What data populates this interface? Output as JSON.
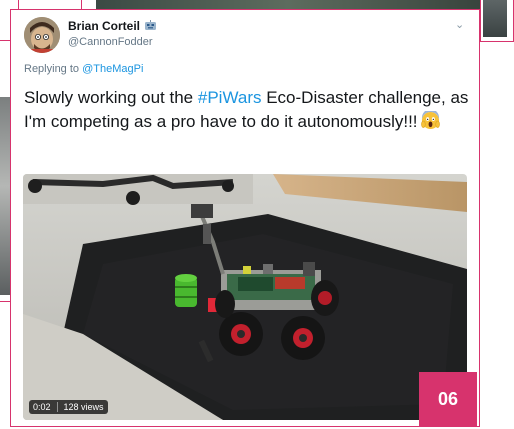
{
  "tweet": {
    "name": "Brian Corteil",
    "handle": "@CannonFodder",
    "reply_prefix": "Replying to",
    "reply_to": "@TheMagPi",
    "text_before": "Slowly working out the ",
    "hashtag": "#PiWars",
    "text_after": " Eco-Disaster challenge, as I'm competing as a  pro have to do it autonomously!!!",
    "emoji": "face-screaming-in-fear",
    "video_time": "0:02",
    "video_views": "128 views"
  },
  "page": {
    "number": "06"
  },
  "colors": {
    "accent": "#d7336d",
    "link": "#1b95e0",
    "text": "#14171a",
    "muted": "#657786"
  }
}
